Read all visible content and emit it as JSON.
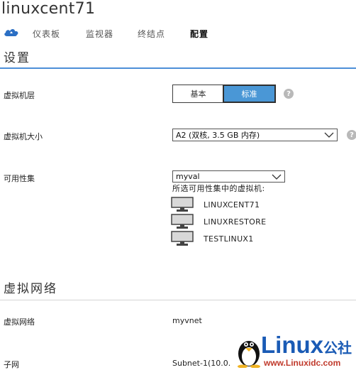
{
  "header": {
    "title": "linuxcent71"
  },
  "nav": {
    "items": [
      {
        "label": "仪表板",
        "active": false
      },
      {
        "label": "监视器",
        "active": false
      },
      {
        "label": "终结点",
        "active": false
      },
      {
        "label": "配置",
        "active": true
      }
    ]
  },
  "settings": {
    "section_title": "设置",
    "tier": {
      "label": "虚拟机层",
      "options": [
        "基本",
        "标准"
      ],
      "selected": "标准",
      "help": "?"
    },
    "size": {
      "label": "虚拟机大小",
      "value": "A2 (双核, 3.5 GB 内存)",
      "help": "?"
    },
    "availability": {
      "label": "可用性集",
      "value": "myval",
      "vms_caption": "所选可用性集中的虚拟机:",
      "vms": [
        "LINUXCENT71",
        "LINUXRESTORE",
        "TESTLINUX1"
      ]
    }
  },
  "network": {
    "section_title": "虚拟网络",
    "vnet": {
      "label": "虚拟网络",
      "value": "myvnet"
    },
    "subnet": {
      "label": "子网",
      "value": "Subnet-1(10.0."
    }
  },
  "watermark": {
    "brand": "Linux",
    "brand_suffix": "公社",
    "url": "www.Linuxidc.com",
    "colors": {
      "brand": "#1a5bb5",
      "url": "#c0392b"
    }
  },
  "colors": {
    "accent": "#4d8fd8",
    "selected_fill": "#4a97d6"
  }
}
